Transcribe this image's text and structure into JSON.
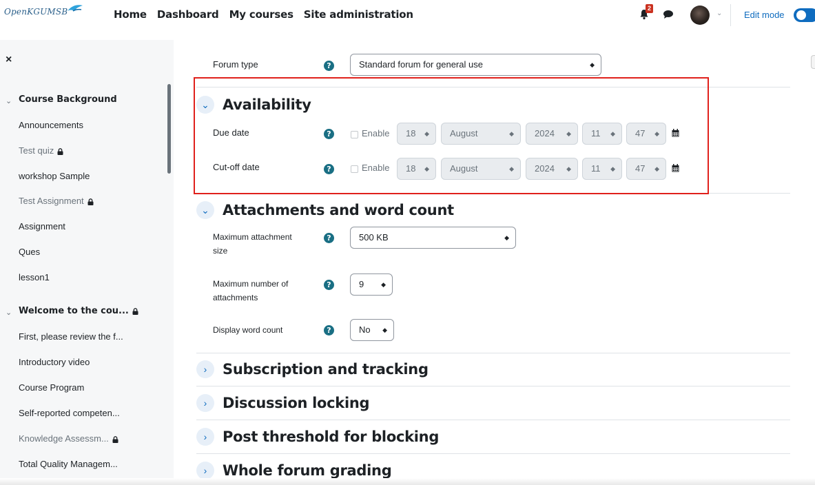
{
  "brand": {
    "text": "OpenKGUMSB"
  },
  "nav": {
    "links": [
      "Home",
      "Dashboard",
      "My courses",
      "Site administration"
    ]
  },
  "header": {
    "notification_count": "2",
    "edit_mode_label": "Edit mode",
    "edit_mode_on": true,
    "icons": [
      "bell-icon",
      "chat-icon",
      "avatar",
      "chevron-down-icon"
    ]
  },
  "sidebar": {
    "close_label": "×",
    "items": [
      {
        "label": "Course Background",
        "type": "section"
      },
      {
        "label": "Announcements",
        "type": "item"
      },
      {
        "label": "Test quiz",
        "type": "item",
        "locked": true
      },
      {
        "label": "workshop Sample",
        "type": "item"
      },
      {
        "label": "Test Assignment",
        "type": "item",
        "locked": true
      },
      {
        "label": "Assignment",
        "type": "item"
      },
      {
        "label": "Ques",
        "type": "item"
      },
      {
        "label": "lesson1",
        "type": "item"
      },
      {
        "label": "Welcome to the cou...",
        "type": "section",
        "locked": true
      },
      {
        "label": "First, please review the f...",
        "type": "item"
      },
      {
        "label": "Introductory video",
        "type": "item"
      },
      {
        "label": "Course Program",
        "type": "item"
      },
      {
        "label": "Self-reported competen...",
        "type": "item"
      },
      {
        "label": "Knowledge Assessm...",
        "type": "item",
        "locked": true
      },
      {
        "label": "Total Quality Managem...",
        "type": "item"
      }
    ]
  },
  "form": {
    "forum_type": {
      "label": "Forum type",
      "value": "Standard forum for general use"
    },
    "availability": {
      "title": "Availability",
      "due_date": {
        "label": "Due date",
        "enable_label": "Enable",
        "day": "18",
        "month": "August",
        "year": "2024",
        "hour": "11",
        "minute": "47"
      },
      "cutoff_date": {
        "label": "Cut-off date",
        "enable_label": "Enable",
        "day": "18",
        "month": "August",
        "year": "2024",
        "hour": "11",
        "minute": "47"
      }
    },
    "attachments": {
      "title": "Attachments and word count",
      "max_size": {
        "label_line1": "Maximum attachment",
        "label_line2": "size",
        "value": "500 KB"
      },
      "max_number": {
        "label_line1": "Maximum number of",
        "label_line2": "attachments",
        "value": "9"
      },
      "word_count": {
        "label": "Display word count",
        "value": "No"
      }
    },
    "collapsed_sections": [
      "Subscription and tracking",
      "Discussion locking",
      "Post threshold for blocking",
      "Whole forum grading"
    ],
    "help_symbol": "?",
    "select_arrow": "◆",
    "chevron_open": "⌄",
    "chevron_closed": "›"
  },
  "colors": {
    "accent": "#0f6cbf",
    "help": "#1a6f84",
    "highlight": "#e0201b",
    "badge": "#ca3120"
  }
}
